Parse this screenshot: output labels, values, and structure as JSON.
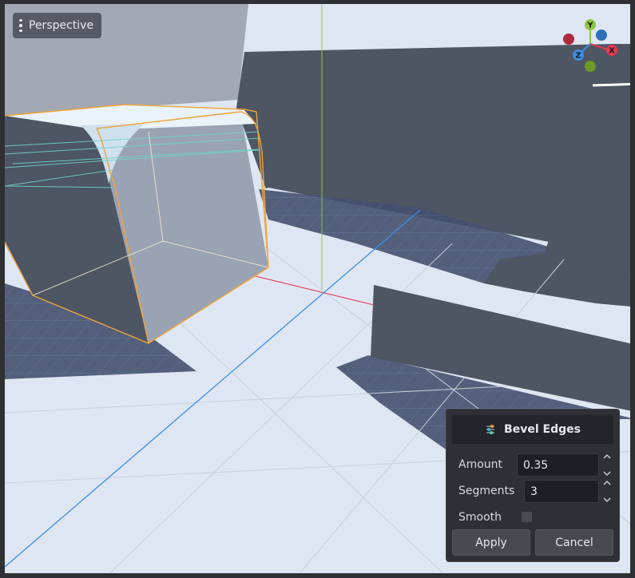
{
  "viewport": {
    "mode_label": "Perspective",
    "menu_icon": "vertical-dots-icon"
  },
  "gizmo": {
    "y_label": "Y",
    "z_label": "Z",
    "x_label": "X",
    "colors": {
      "y": "#8cc63f",
      "x": "#e8384f",
      "z": "#3a8ee6",
      "neg_y": "#6a9a2a",
      "neg_x": "#b02a3e",
      "neg_z": "#2f70b8"
    }
  },
  "bevel_panel": {
    "icon": "sliders-icon",
    "title": "Bevel Edges",
    "amount_label": "Amount",
    "amount_value": "0.35",
    "segments_label": "Segments",
    "segments_value": "3",
    "smooth_label": "Smooth",
    "smooth_checked": false,
    "apply_label": "Apply",
    "cancel_label": "Cancel"
  }
}
